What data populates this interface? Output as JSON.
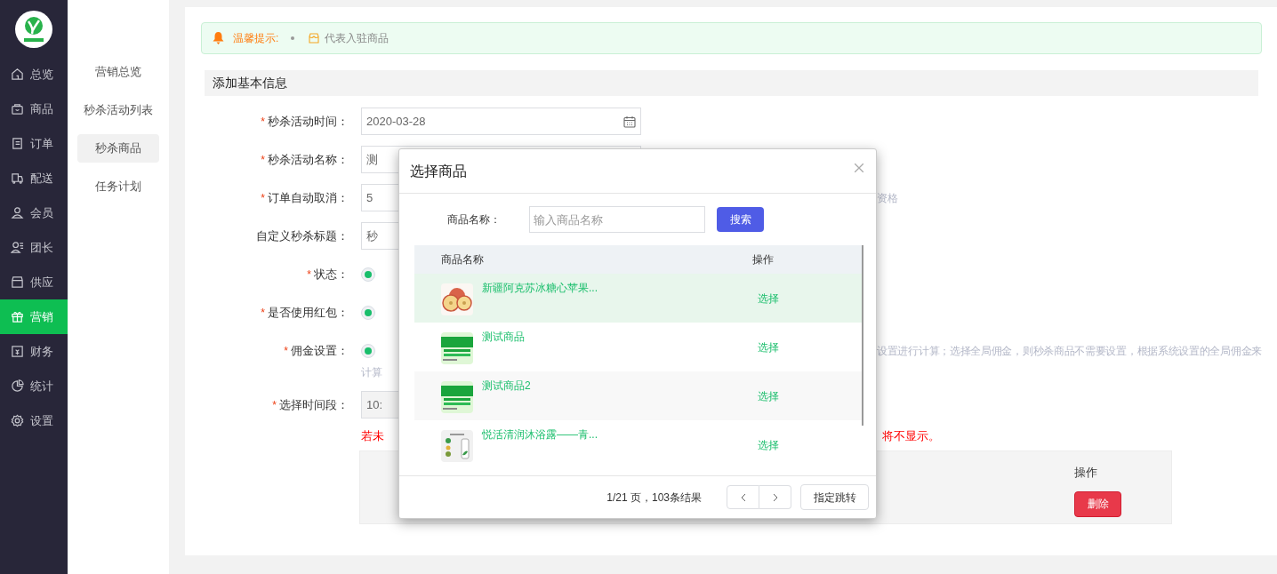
{
  "sidebar": {
    "items": [
      {
        "label": "总览",
        "selected": false
      },
      {
        "label": "商品",
        "selected": false
      },
      {
        "label": "订单",
        "selected": false
      },
      {
        "label": "配送",
        "selected": false
      },
      {
        "label": "会员",
        "selected": false
      },
      {
        "label": "团长",
        "selected": false
      },
      {
        "label": "供应",
        "selected": false
      },
      {
        "label": "营销",
        "selected": true
      },
      {
        "label": "财务",
        "selected": false
      },
      {
        "label": "统计",
        "selected": false
      },
      {
        "label": "设置",
        "selected": false
      }
    ]
  },
  "submenu": {
    "items": [
      {
        "label": "营销总览",
        "selected": false
      },
      {
        "label": "秒杀活动列表",
        "selected": false
      },
      {
        "label": "秒杀商品",
        "selected": true
      },
      {
        "label": "任务计划",
        "selected": false
      }
    ]
  },
  "notice": {
    "title": "温馨提示:",
    "items": [
      "代表入驻商品"
    ]
  },
  "section_title": "添加基本信息",
  "form": {
    "fields": [
      {
        "kind": "date",
        "required_mark": "*",
        "label": "秒杀活动时间：",
        "value": "2020-03-28"
      },
      {
        "kind": "text",
        "required_mark": "*",
        "label": "秒杀活动名称：",
        "value": "测"
      },
      {
        "kind": "text",
        "required_mark": "*",
        "label": "订单自动取消：",
        "value": "5",
        "note": "资格"
      },
      {
        "kind": "text",
        "label": "自定义秒杀标题：",
        "value": "秒"
      },
      {
        "kind": "radio",
        "required_mark": "*",
        "label": "状态：",
        "checked": true
      },
      {
        "kind": "radio",
        "required_mark": "*",
        "label": "是否使用红包：",
        "checked": true
      },
      {
        "kind": "radio",
        "required_mark": "*",
        "label": "佣金设置：",
        "checked": true,
        "note": "设置进行计算；选择全局佣金，则秒杀商品不需要设置，根据系统设置的全局佣金来",
        "note_line_2": "计算"
      },
      {
        "kind": "select",
        "required_mark": "*",
        "label": "选择时间段：",
        "value": "10:"
      }
    ]
  },
  "warning": {
    "left": "若未",
    "right": "将不显示。"
  },
  "selected_table": {
    "columns": [
      "操作"
    ],
    "rows": [
      {
        "action": "删除"
      }
    ]
  },
  "modal": {
    "title": "选择商品",
    "search_label": "商品名称：",
    "search_placeholder": "输入商品名称",
    "search_button": "搜索",
    "columns": [
      "商品名称",
      "操作"
    ],
    "rows": [
      {
        "name": "新疆阿克苏冰糖心苹果...",
        "action": "选择",
        "selected": true
      },
      {
        "name": "测试商品",
        "action": "选择",
        "selected": false
      },
      {
        "name": "测试商品2",
        "action": "选择",
        "selected": false
      },
      {
        "name": "悦活清润沐浴露——青...",
        "action": "选择",
        "selected": false
      }
    ],
    "pagination": "1/21 页，103条结果",
    "jump_button": "指定跳转"
  }
}
